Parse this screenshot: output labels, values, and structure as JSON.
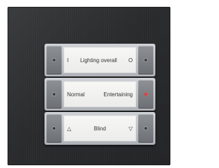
{
  "rows": [
    {
      "left": "I",
      "right": "O",
      "center": "Lighting overall"
    },
    {
      "left": "Normal",
      "right": "Entertaining"
    },
    {
      "left": "△",
      "right": "▽",
      "center": "Blind"
    }
  ],
  "status_led_color": "#e03a3a"
}
